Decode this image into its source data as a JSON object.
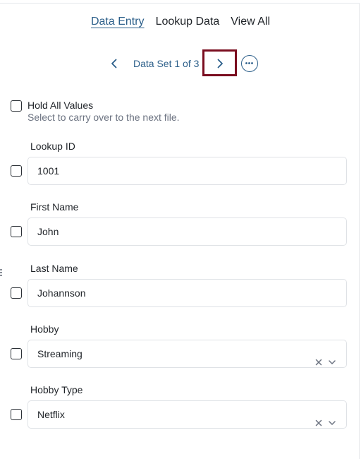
{
  "tabs": [
    {
      "label": "Data Entry",
      "active": true
    },
    {
      "label": "Lookup Data",
      "active": false
    },
    {
      "label": "View All",
      "active": false
    }
  ],
  "pager": {
    "label": "Data Set 1 of 3",
    "prev_icon": "chevron-left-icon",
    "next_icon": "chevron-right-icon",
    "more_icon": "more-horizontal-icon"
  },
  "hold": {
    "title": "Hold All Values",
    "subtitle": "Select to carry over to the next file."
  },
  "fields": {
    "lookup_id": {
      "label": "Lookup ID",
      "value": "1001"
    },
    "first_name": {
      "label": "First Name",
      "value": "John"
    },
    "last_name": {
      "label": "Last Name",
      "value": "Johannson"
    },
    "hobby": {
      "label": "Hobby",
      "value": "Streaming"
    },
    "hobby_type": {
      "label": "Hobby Type",
      "value": "Netflix"
    }
  },
  "colors": {
    "accent": "#2c5f8a",
    "highlight_border": "#7a0d1f"
  }
}
